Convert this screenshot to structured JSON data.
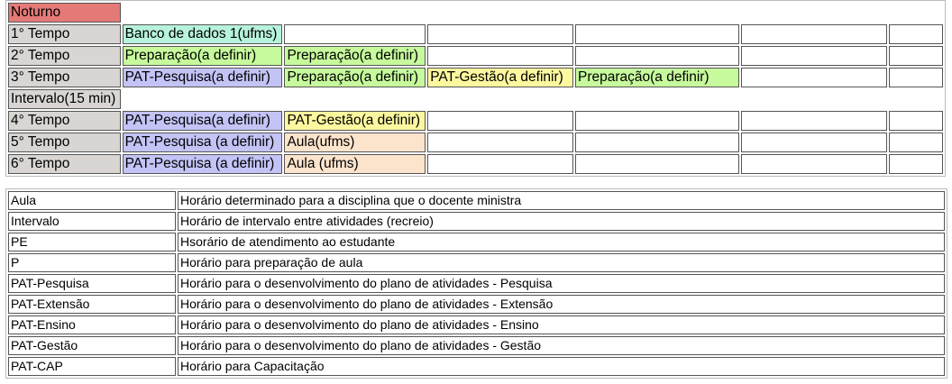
{
  "schedule": {
    "header": "Noturno",
    "rows": [
      {
        "label": "1° Tempo",
        "cells": [
          {
            "text": "Banco de dados 1(ufms)",
            "type": "bd"
          }
        ]
      },
      {
        "label": "2° Tempo",
        "cells": [
          {
            "text": "Preparação(a definir)",
            "type": "prep"
          },
          {
            "text": "Preparação(a definir)",
            "type": "prep"
          }
        ]
      },
      {
        "label": "3° Tempo",
        "cells": [
          {
            "text": "PAT-Pesquisa(a definir)",
            "type": "pesq"
          },
          {
            "text": "Preparação(a definir)",
            "type": "prep"
          },
          {
            "text": "PAT-Gestão(a definir)",
            "type": "gestao"
          },
          {
            "text": "Preparação(a definir)",
            "type": "prep"
          }
        ]
      },
      {
        "label": "Intervalo(15 min)",
        "break": true
      },
      {
        "label": "4° Tempo",
        "cells": [
          {
            "text": "PAT-Pesquisa(a definir)",
            "type": "pesq"
          },
          {
            "text": "PAT-Gestão(a definir)",
            "type": "gestao"
          }
        ]
      },
      {
        "label": "5° Tempo",
        "cells": [
          {
            "text": "PAT-Pesquisa (a definir)",
            "type": "pesq"
          },
          {
            "text": "Aula(ufms)",
            "type": "aula"
          }
        ]
      },
      {
        "label": "6° Tempo",
        "cells": [
          {
            "text": "PAT-Pesquisa (a definir)",
            "type": "pesq"
          },
          {
            "text": "Aula (ufms)",
            "type": "aula"
          }
        ]
      }
    ]
  },
  "legend": [
    {
      "term": "Aula",
      "description": "Horário determinado para a disciplina que o docente ministra"
    },
    {
      "term": "Intervalo",
      "description": "Horário de intervalo entre atividades (recreio)"
    },
    {
      "term": "PE",
      "description": "Hsorário de atendimento ao estudante"
    },
    {
      "term": "P",
      "description": "Horário para preparação de aula"
    },
    {
      "term": "PAT-Pesquisa",
      "description": "Horário para o desenvolvimento do plano de atividades - Pesquisa"
    },
    {
      "term": "PAT-Extensão",
      "description": "Horário para o desenvolvimento do plano de atividades - Extensão"
    },
    {
      "term": "PAT-Ensino",
      "description": "Horário para o desenvolvimento do plano de atividades - Ensino"
    },
    {
      "term": "PAT-Gestão",
      "description": "Horário para o desenvolvimento do plano de atividades - Gestão"
    },
    {
      "term": "PAT-CAP",
      "description": "Horário para Capacitação"
    }
  ]
}
